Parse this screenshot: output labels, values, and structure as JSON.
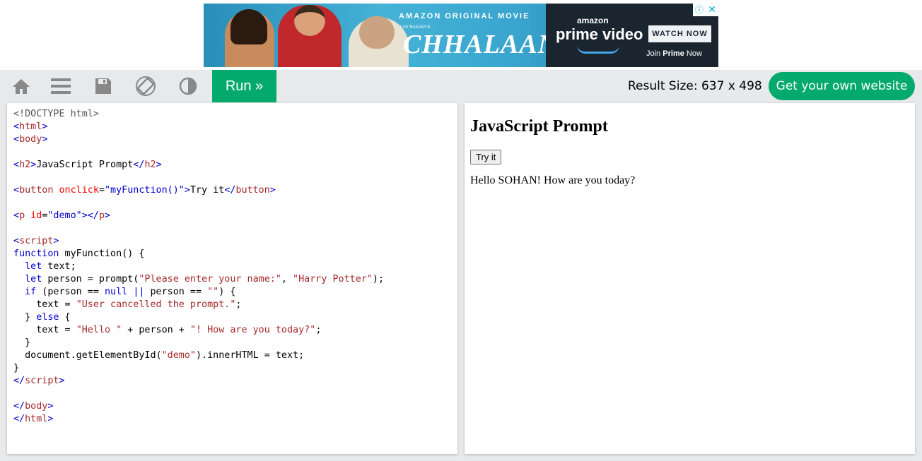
{
  "ad": {
    "eyebrow": "AMAZON ORIGINAL MOVIE",
    "presenter": "LUV RANJAN'S",
    "movie_title": "CHHALAANG",
    "brand_top": "amazon",
    "brand_main": "prime video",
    "cta": "WATCH NOW",
    "join_prefix": "Join ",
    "join_bold": "Prime",
    "join_suffix": " Now",
    "info_glyph": "ⓘ",
    "close_glyph": "✕"
  },
  "toolbar": {
    "icons": [
      "home-icon",
      "menu-icon",
      "save-icon",
      "rotate-icon",
      "contrast-icon"
    ],
    "run_label": "Run »",
    "result_size_label": "Result Size: 637 x 498",
    "get_site_label": "Get your own website"
  },
  "code_lines": [
    [
      {
        "t": "doc",
        "v": "<!DOCTYPE html>"
      }
    ],
    [
      {
        "t": "brk",
        "v": "<"
      },
      {
        "t": "tag",
        "v": "html"
      },
      {
        "t": "brk",
        "v": ">"
      }
    ],
    [
      {
        "t": "brk",
        "v": "<"
      },
      {
        "t": "tag",
        "v": "body"
      },
      {
        "t": "brk",
        "v": ">"
      }
    ],
    [],
    [
      {
        "t": "brk",
        "v": "<"
      },
      {
        "t": "tag",
        "v": "h2"
      },
      {
        "t": "brk",
        "v": ">"
      },
      {
        "t": "plain",
        "v": "JavaScript Prompt"
      },
      {
        "t": "brk",
        "v": "</"
      },
      {
        "t": "tag",
        "v": "h2"
      },
      {
        "t": "brk",
        "v": ">"
      }
    ],
    [],
    [
      {
        "t": "brk",
        "v": "<"
      },
      {
        "t": "tag",
        "v": "button"
      },
      {
        "t": "plain",
        "v": " "
      },
      {
        "t": "attr",
        "v": "onclick"
      },
      {
        "t": "plain",
        "v": "="
      },
      {
        "t": "val",
        "v": "\"myFunction()\""
      },
      {
        "t": "brk",
        "v": ">"
      },
      {
        "t": "plain",
        "v": "Try it"
      },
      {
        "t": "brk",
        "v": "</"
      },
      {
        "t": "tag",
        "v": "button"
      },
      {
        "t": "brk",
        "v": ">"
      }
    ],
    [],
    [
      {
        "t": "brk",
        "v": "<"
      },
      {
        "t": "tag",
        "v": "p"
      },
      {
        "t": "plain",
        "v": " "
      },
      {
        "t": "attr",
        "v": "id"
      },
      {
        "t": "plain",
        "v": "="
      },
      {
        "t": "val",
        "v": "\"demo\""
      },
      {
        "t": "brk",
        "v": "></"
      },
      {
        "t": "tag",
        "v": "p"
      },
      {
        "t": "brk",
        "v": ">"
      }
    ],
    [],
    [
      {
        "t": "brk",
        "v": "<"
      },
      {
        "t": "tag",
        "v": "script"
      },
      {
        "t": "brk",
        "v": ">"
      }
    ],
    [
      {
        "t": "kw",
        "v": "function"
      },
      {
        "t": "plain",
        "v": " myFunction() {"
      }
    ],
    [
      {
        "t": "plain",
        "v": "  "
      },
      {
        "t": "kw",
        "v": "let"
      },
      {
        "t": "plain",
        "v": " text;"
      }
    ],
    [
      {
        "t": "plain",
        "v": "  "
      },
      {
        "t": "kw",
        "v": "let"
      },
      {
        "t": "plain",
        "v": " person = prompt("
      },
      {
        "t": "str",
        "v": "\"Please enter your name:\""
      },
      {
        "t": "plain",
        "v": ", "
      },
      {
        "t": "str",
        "v": "\"Harry Potter\""
      },
      {
        "t": "plain",
        "v": ");"
      }
    ],
    [
      {
        "t": "plain",
        "v": "  "
      },
      {
        "t": "kw",
        "v": "if"
      },
      {
        "t": "plain",
        "v": " (person == "
      },
      {
        "t": "kw",
        "v": "null"
      },
      {
        "t": "plain",
        "v": " "
      },
      {
        "t": "kw",
        "v": "||"
      },
      {
        "t": "plain",
        "v": " person == "
      },
      {
        "t": "str",
        "v": "\"\""
      },
      {
        "t": "plain",
        "v": ") {"
      }
    ],
    [
      {
        "t": "plain",
        "v": "    text = "
      },
      {
        "t": "str",
        "v": "\"User cancelled the prompt.\""
      },
      {
        "t": "plain",
        "v": ";"
      }
    ],
    [
      {
        "t": "plain",
        "v": "  } "
      },
      {
        "t": "kw",
        "v": "else"
      },
      {
        "t": "plain",
        "v": " {"
      }
    ],
    [
      {
        "t": "plain",
        "v": "    text = "
      },
      {
        "t": "str",
        "v": "\"Hello \""
      },
      {
        "t": "plain",
        "v": " + person + "
      },
      {
        "t": "str",
        "v": "\"! How are you today?\""
      },
      {
        "t": "plain",
        "v": ";"
      }
    ],
    [
      {
        "t": "plain",
        "v": "  }"
      }
    ],
    [
      {
        "t": "plain",
        "v": "  document.getElementById("
      },
      {
        "t": "str",
        "v": "\"demo\""
      },
      {
        "t": "plain",
        "v": ").innerHTML = text;"
      }
    ],
    [
      {
        "t": "plain",
        "v": "}"
      }
    ],
    [
      {
        "t": "brk",
        "v": "</"
      },
      {
        "t": "tag",
        "v": "script"
      },
      {
        "t": "brk",
        "v": ">"
      }
    ],
    [],
    [
      {
        "t": "brk",
        "v": "</"
      },
      {
        "t": "tag",
        "v": "body"
      },
      {
        "t": "brk",
        "v": ">"
      }
    ],
    [
      {
        "t": "brk",
        "v": "</"
      },
      {
        "t": "tag",
        "v": "html"
      },
      {
        "t": "brk",
        "v": ">"
      }
    ]
  ],
  "result": {
    "heading": "JavaScript Prompt",
    "button_label": "Try it",
    "output": "Hello SOHAN! How are you today?"
  },
  "colors": {
    "accent_green": "#04aa6d",
    "toolbar_bg": "#e7e9eb",
    "icon_gray": "#888888"
  }
}
